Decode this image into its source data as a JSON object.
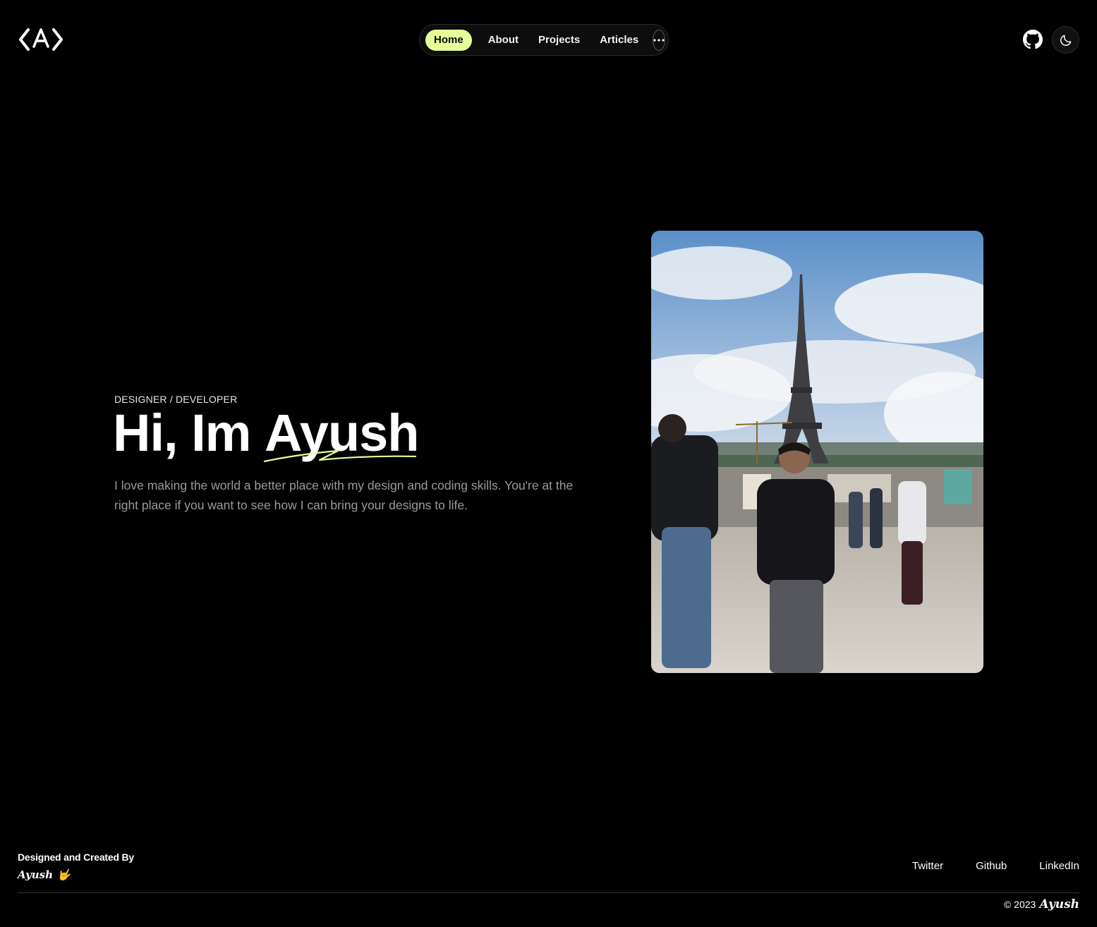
{
  "header": {
    "logo_icon": "code-bracket-a-logo",
    "nav": {
      "items": [
        {
          "label": "Home",
          "active": true
        },
        {
          "label": "About",
          "active": false
        },
        {
          "label": "Projects",
          "active": false
        },
        {
          "label": "Articles",
          "active": false
        }
      ],
      "more_icon": "ellipsis-icon"
    },
    "github_icon": "github-icon",
    "theme_icon": "moon-icon",
    "accent_color": "#e6ff96"
  },
  "hero": {
    "eyebrow": "DESIGNER / DEVELOPER",
    "title_prefix": "Hi, Im ",
    "title_name": "Ayush",
    "description": "I love making the world a better place with my design and coding skills. You're at the right place if you want to see how I can bring your designs to life.",
    "photo_alt": "Photo of Ayush in front of the Eiffel Tower"
  },
  "footer": {
    "credit": "Designed and Created By",
    "signature": "Ayush",
    "signature_emoji": "🤟",
    "links": [
      "Twitter",
      "Github",
      "LinkedIn"
    ],
    "copyright_prefix": "© 2023",
    "copyright_name": "Ayush"
  }
}
